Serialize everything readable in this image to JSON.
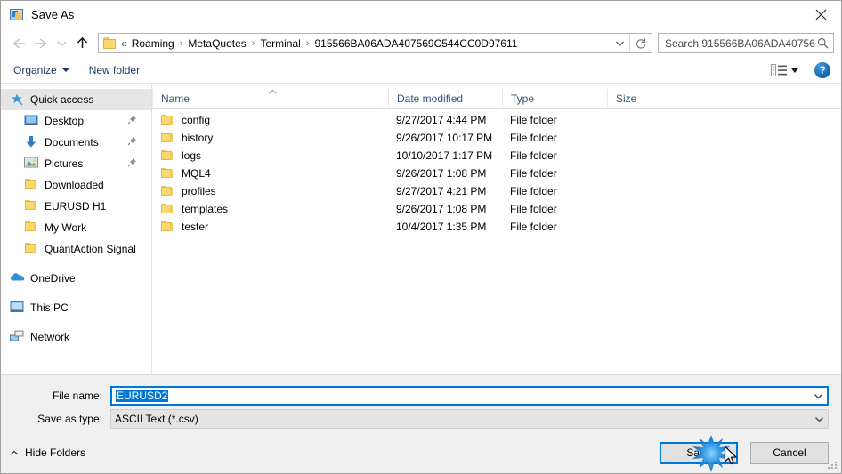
{
  "window": {
    "title": "Save As",
    "app_icon": "picture-user-icon",
    "close_label": "✕"
  },
  "nav": {
    "back_icon": "arrow-left-icon",
    "forward_icon": "arrow-right-icon",
    "recent_icon": "chevron-down-icon",
    "up_icon": "arrow-up-icon"
  },
  "address": {
    "folder_icon": "folder-icon",
    "lead": "«",
    "crumbs": [
      "Roaming",
      "MetaQuotes",
      "Terminal",
      "915566BA06ADA407569C544CC0D97611"
    ],
    "separator": "›",
    "dropdown_icon": "chevron-down-icon",
    "refresh_icon": "refresh-icon"
  },
  "search": {
    "placeholder": "Search 915566BA06ADA40756...",
    "icon": "search-icon"
  },
  "commandbar": {
    "organize_label": "Organize",
    "new_folder_label": "New folder",
    "layout_icon": "view-layout-icon",
    "help_label": "?"
  },
  "sidebar": {
    "items": [
      {
        "label": "Quick access",
        "icon": "star-pin-icon",
        "selected": true,
        "indent": false,
        "pinned": false,
        "group": false
      },
      {
        "label": "Desktop",
        "icon": "monitor-icon",
        "selected": false,
        "indent": true,
        "pinned": true,
        "group": false
      },
      {
        "label": "Documents",
        "icon": "download-arrow-icon",
        "selected": false,
        "indent": true,
        "pinned": true,
        "group": false
      },
      {
        "label": "Pictures",
        "icon": "picture-icon",
        "selected": false,
        "indent": true,
        "pinned": true,
        "group": false
      },
      {
        "label": "Downloaded",
        "icon": "folder-icon",
        "selected": false,
        "indent": true,
        "pinned": false,
        "group": false
      },
      {
        "label": "EURUSD H1",
        "icon": "folder-icon",
        "selected": false,
        "indent": true,
        "pinned": false,
        "group": false
      },
      {
        "label": "My Work",
        "icon": "folder-icon",
        "selected": false,
        "indent": true,
        "pinned": false,
        "group": false
      },
      {
        "label": "QuantAction Signal",
        "icon": "folder-icon",
        "selected": false,
        "indent": true,
        "pinned": false,
        "group": false
      },
      {
        "label": "OneDrive",
        "icon": "cloud-icon",
        "selected": false,
        "indent": false,
        "pinned": false,
        "group": true
      },
      {
        "label": "This PC",
        "icon": "computer-icon",
        "selected": false,
        "indent": false,
        "pinned": false,
        "group": true
      },
      {
        "label": "Network",
        "icon": "network-icon",
        "selected": false,
        "indent": false,
        "pinned": false,
        "group": true
      }
    ]
  },
  "filelist": {
    "columns": [
      "Name",
      "Date modified",
      "Type",
      "Size"
    ],
    "sort_column": "Name",
    "sort_direction": "ascending",
    "rows": [
      {
        "name": "config",
        "date": "9/27/2017 4:44 PM",
        "type": "File folder",
        "size": ""
      },
      {
        "name": "history",
        "date": "9/26/2017 10:17 PM",
        "type": "File folder",
        "size": ""
      },
      {
        "name": "logs",
        "date": "10/10/2017 1:17 PM",
        "type": "File folder",
        "size": ""
      },
      {
        "name": "MQL4",
        "date": "9/26/2017 1:08 PM",
        "type": "File folder",
        "size": ""
      },
      {
        "name": "profiles",
        "date": "9/27/2017 4:21 PM",
        "type": "File folder",
        "size": ""
      },
      {
        "name": "templates",
        "date": "9/26/2017 1:08 PM",
        "type": "File folder",
        "size": ""
      },
      {
        "name": "tester",
        "date": "10/4/2017 1:35 PM",
        "type": "File folder",
        "size": ""
      }
    ]
  },
  "form": {
    "filename_label": "File name:",
    "filename_value": "EURUSD2",
    "filetype_label": "Save as type:",
    "filetype_value": "ASCII Text (*.csv)"
  },
  "footer": {
    "hide_folders_label": "Hide Folders",
    "hide_folders_icon": "chevron-up-icon",
    "save_label": "Save",
    "cancel_label": "Cancel",
    "resize_grip_icon": "resize-grip-icon",
    "cursor_icon": "arrow-cursor-icon",
    "click_indicator": "click-burst-icon"
  },
  "colors": {
    "accent": "#0078d7",
    "folder": "#fcd96e",
    "chrome": "#f0f0f0",
    "header_text": "#35557e"
  }
}
